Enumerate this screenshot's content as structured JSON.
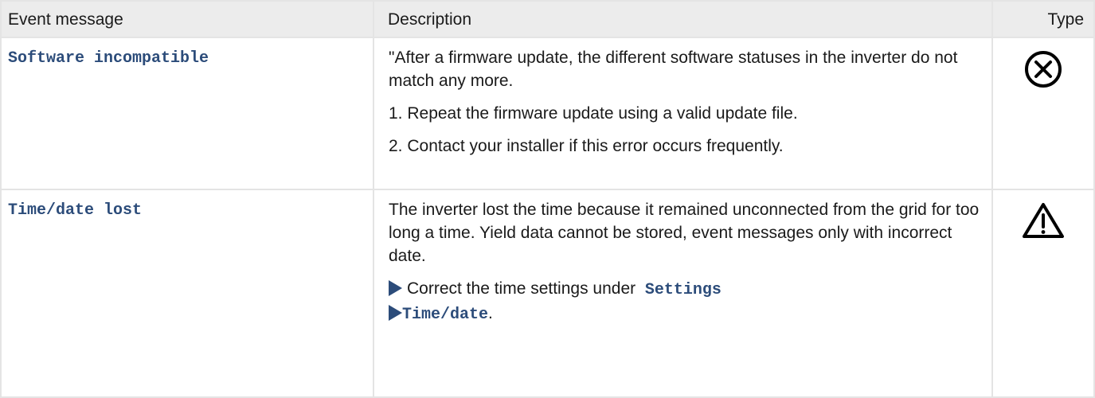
{
  "headers": {
    "event_message": "Event message",
    "description": "Description",
    "type": "Type"
  },
  "rows": [
    {
      "event": "Software incompatible",
      "paragraphs": [
        "\"After a firmware update, the different software sta­tuses in the inverter do not match any more.",
        "1. Repeat the firmware update using a valid update file.",
        "2. Contact your installer if this error occurs frequently."
      ],
      "type_icon": "error-circle-x-icon"
    },
    {
      "event": "Time/date lost",
      "paragraphs": [
        "The inverter lost the time because it remained uncon­nected from the grid for too long a time. Yield data cannot be stored, event messages only with incorrect date."
      ],
      "instruction": {
        "text": "Correct the time settings under",
        "menu_path_1": "Settings",
        "menu_path_2": "Time/date",
        "end": "."
      },
      "type_icon": "warning-triangle-icon"
    }
  ],
  "colors": {
    "code": "#2c4c7a",
    "header_bg": "#ececec",
    "border": "#e4e4e4"
  }
}
